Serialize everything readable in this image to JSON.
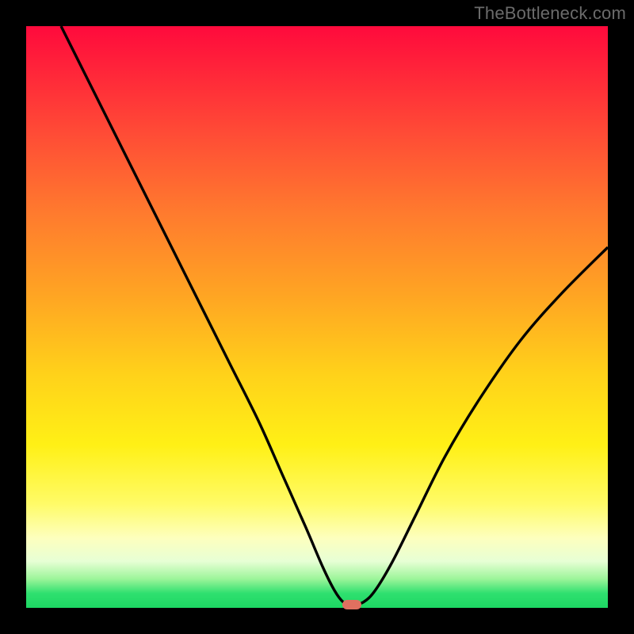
{
  "watermark": "TheBottleneck.com",
  "chart_data": {
    "type": "line",
    "title": "",
    "xlabel": "",
    "ylabel": "",
    "xlim": [
      0,
      100
    ],
    "ylim": [
      0,
      100
    ],
    "grid": false,
    "legend": false,
    "background_gradient": {
      "direction": "vertical",
      "stops": [
        {
          "pos": 0,
          "color": "#ff0a3c"
        },
        {
          "pos": 18,
          "color": "#ff4a36"
        },
        {
          "pos": 46,
          "color": "#ffa423"
        },
        {
          "pos": 72,
          "color": "#fff016"
        },
        {
          "pos": 92,
          "color": "#e7ffd5"
        },
        {
          "pos": 100,
          "color": "#1dd763"
        }
      ]
    },
    "series": [
      {
        "name": "bottleneck-curve",
        "x": [
          6,
          10,
          15,
          20,
          25,
          30,
          35,
          40,
          44,
          48,
          51,
          53,
          54.5,
          56,
          58,
          60,
          63,
          67,
          72,
          78,
          85,
          92,
          100
        ],
        "y": [
          100,
          92,
          82,
          72,
          62,
          52,
          42,
          32,
          23,
          14,
          7,
          3,
          1,
          0.5,
          1,
          3,
          8,
          16,
          26,
          36,
          46,
          54,
          62
        ]
      }
    ],
    "marker": {
      "x": 56,
      "y": 0.5,
      "color": "#e07060",
      "shape": "pill"
    }
  }
}
